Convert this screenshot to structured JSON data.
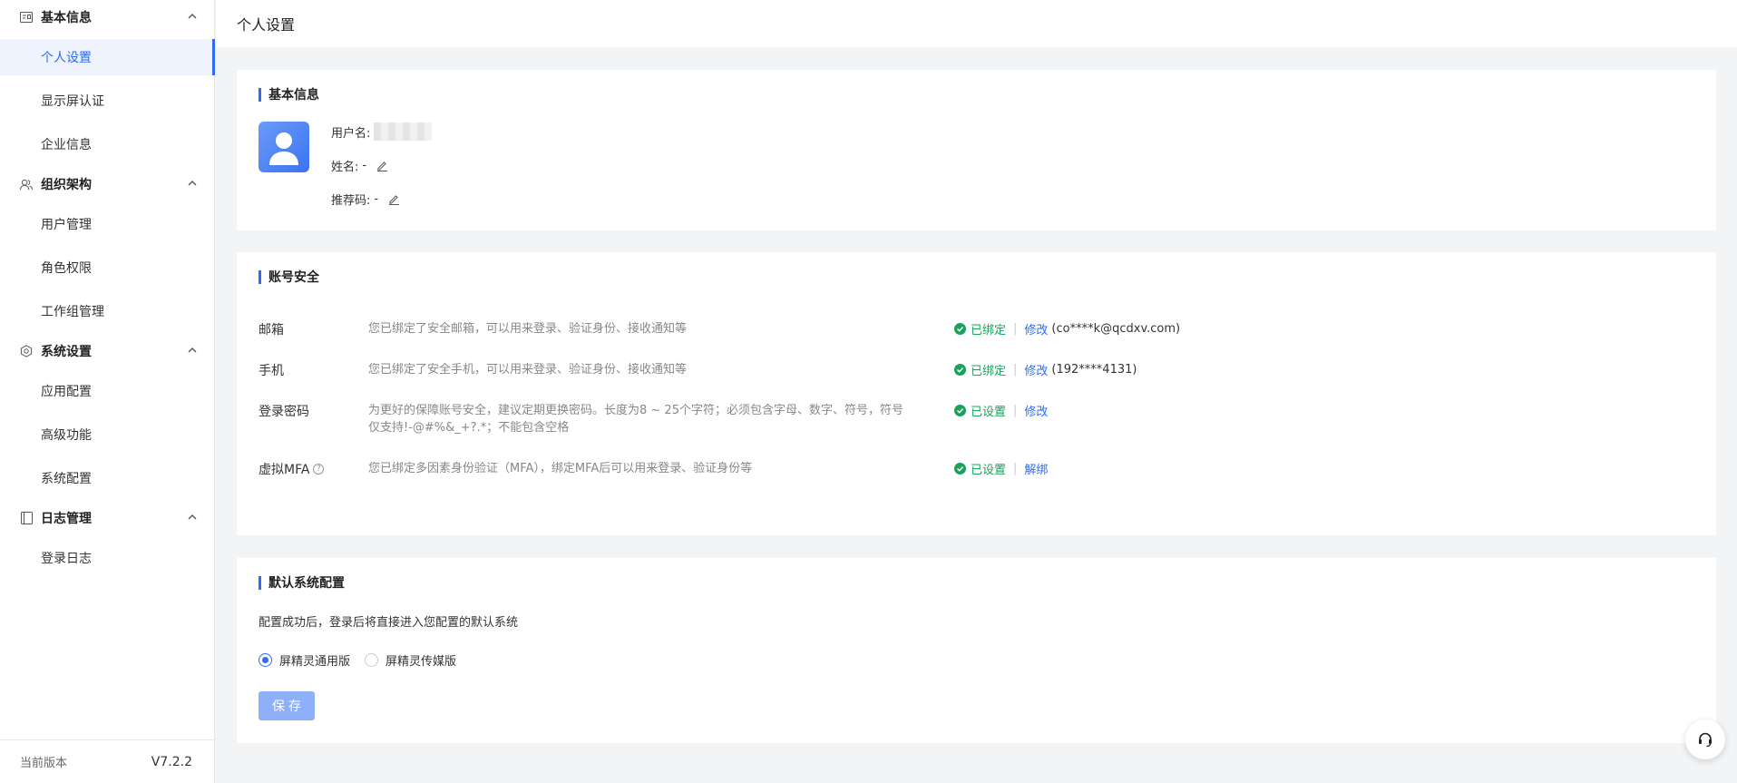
{
  "sidebar": {
    "groups": [
      {
        "title": "基本信息",
        "icon": "id-card-icon",
        "items": [
          "个人设置",
          "显示屏认证",
          "企业信息"
        ]
      },
      {
        "title": "组织架构",
        "icon": "users-icon",
        "items": [
          "用户管理",
          "角色权限",
          "工作组管理"
        ]
      },
      {
        "title": "系统设置",
        "icon": "hexagon-settings-icon",
        "items": [
          "应用配置",
          "高级功能",
          "系统配置"
        ]
      },
      {
        "title": "日志管理",
        "icon": "book-icon",
        "items": [
          "登录日志"
        ]
      }
    ],
    "active_item": "个人设置",
    "footer": {
      "label": "当前版本",
      "version": "V7.2.2"
    }
  },
  "header": {
    "title": "个人设置"
  },
  "basic_info": {
    "title": "基本信息",
    "username_label": "用户名:",
    "name_label": "姓名:",
    "name_value": "-",
    "referral_label": "推荐码:",
    "referral_value": "-"
  },
  "security": {
    "title": "账号安全",
    "rows": [
      {
        "name": "邮箱",
        "desc": "您已绑定了安全邮箱，可以用来登录、验证身份、接收通知等",
        "status": "已绑定",
        "action": "修改",
        "extra": "(co****k@qcdxv.com)"
      },
      {
        "name": "手机",
        "desc": "您已绑定了安全手机，可以用来登录、验证身份、接收通知等",
        "status": "已绑定",
        "action": "修改",
        "extra": "(192****4131)"
      },
      {
        "name": "登录密码",
        "desc": "为更好的保障账号安全，建议定期更换密码。长度为8 ~ 25个字符；必须包含字母、数字、符号，符号仅支持!-@#%&_+?.*；不能包含空格",
        "status": "已设置",
        "action": "修改",
        "extra": ""
      },
      {
        "name": "虚拟MFA",
        "desc": "您已绑定多因素身份验证（MFA），绑定MFA后可以用来登录、验证身份等",
        "status": "已设置",
        "action": "解绑",
        "extra": ""
      }
    ]
  },
  "default_system": {
    "title": "默认系统配置",
    "desc": "配置成功后，登录后将直接进入您配置的默认系统",
    "options": [
      "屏精灵通用版",
      "屏精灵传媒版"
    ],
    "selected": "屏精灵通用版",
    "save_label": "保存"
  },
  "colors": {
    "accent": "#2f6bf6",
    "success": "#19a35b"
  }
}
